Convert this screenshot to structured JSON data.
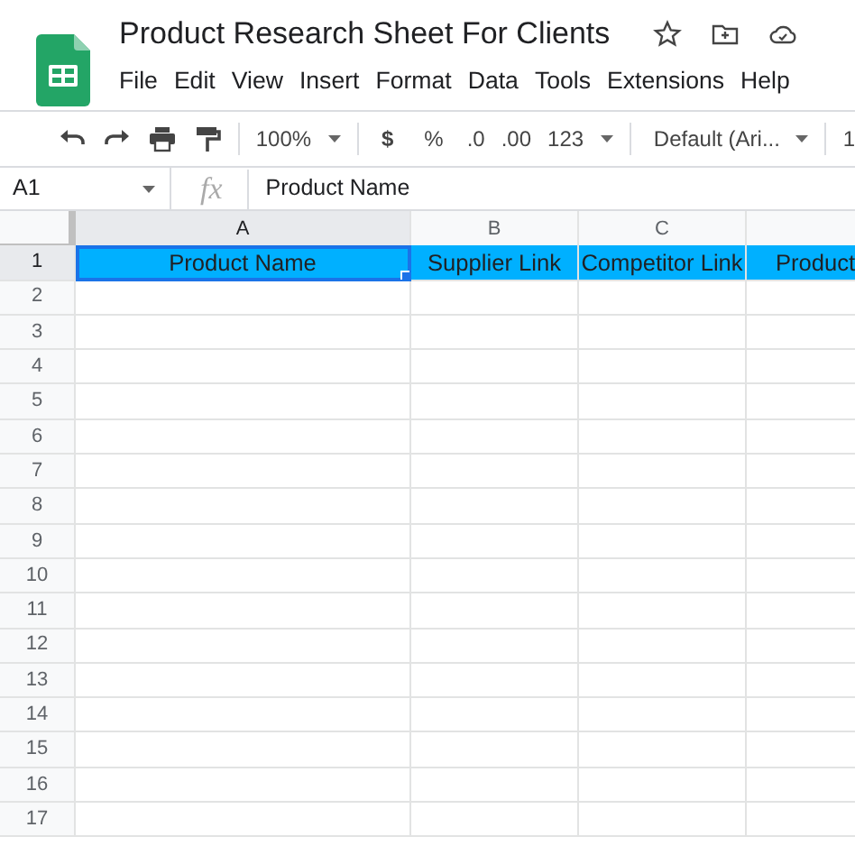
{
  "window": {
    "title": "Product Research Sheet For Clients"
  },
  "menu": [
    "File",
    "Edit",
    "View",
    "Insert",
    "Format",
    "Data",
    "Tools",
    "Extensions",
    "Help"
  ],
  "toolbar": {
    "zoom": "100%",
    "currency": "$",
    "percent": "%",
    "decrease_decimals": ".0",
    "increase_decimals": ".00",
    "number_format": "123",
    "font": "Default (Ari...",
    "font_size": "1"
  },
  "formula_bar": {
    "name_box": "A1",
    "fx": "fx",
    "value": "Product Name"
  },
  "columns": [
    {
      "label": "A",
      "selected": true
    },
    {
      "label": "B",
      "selected": false
    },
    {
      "label": "C",
      "selected": false
    },
    {
      "selected": false
    }
  ],
  "rows": [
    {
      "number": "1",
      "selected": true,
      "cells": [
        "Product Name",
        "Supplier Link",
        "Competitor Link",
        "Product"
      ]
    },
    {
      "number": "2",
      "selected": false,
      "cells": []
    },
    {
      "number": "3",
      "selected": false,
      "cells": []
    },
    {
      "number": "4",
      "selected": false,
      "cells": []
    },
    {
      "number": "5",
      "selected": false,
      "cells": []
    },
    {
      "number": "6",
      "selected": false,
      "cells": []
    },
    {
      "number": "7",
      "selected": false,
      "cells": []
    },
    {
      "number": "8",
      "selected": false,
      "cells": []
    },
    {
      "number": "9",
      "selected": false,
      "cells": []
    },
    {
      "number": "10",
      "selected": false,
      "cells": []
    },
    {
      "number": "11",
      "selected": false,
      "cells": []
    },
    {
      "number": "12",
      "selected": false,
      "cells": []
    },
    {
      "number": "13",
      "selected": false,
      "cells": []
    },
    {
      "number": "14",
      "selected": false,
      "cells": []
    },
    {
      "number": "15",
      "selected": false,
      "cells": []
    },
    {
      "number": "16",
      "selected": false,
      "cells": []
    },
    {
      "number": "17",
      "selected": false,
      "cells": []
    }
  ]
}
